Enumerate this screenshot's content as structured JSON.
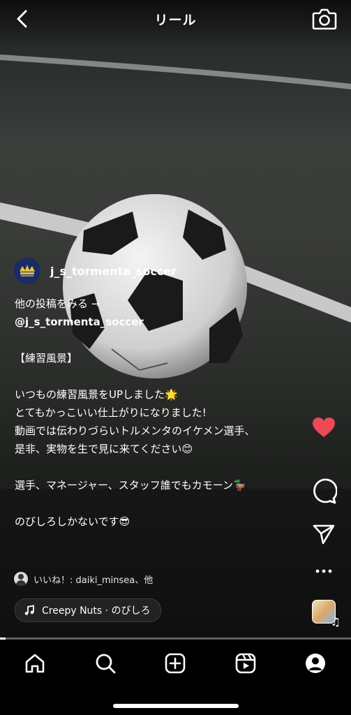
{
  "header": {
    "title": "リール"
  },
  "post": {
    "username": "j_s_tormenta_soccer",
    "caption": {
      "line1": "他の投稿をみる →",
      "line2": "@j_s_tormenta_soccer",
      "line3": "【練習風景】",
      "line4": "いつもの練習風景をUPしました🌟",
      "line5": "とてもかっこいい仕上がりになりました!",
      "line6": "動画では伝わりづらいトルメンタのイケメン選手、",
      "line7": "是非、実物を生で見に来てください😊",
      "line8": "選手、マネージャー、スタッフ誰でもカモーン🦆",
      "line9": "のびしろしかないです😎"
    },
    "likes_text": "いいね！: daiki_minsea、他",
    "music": "Creepy Nuts · のびしろ",
    "progress": 0.016
  },
  "colors": {
    "like": "#ed4956",
    "background": "#000000"
  },
  "icons": {
    "back": "chevron-left-icon",
    "camera": "camera-icon",
    "like": "heart-icon",
    "comment": "comment-icon",
    "share": "paper-plane-icon",
    "more": "more-icon",
    "home": "home-icon",
    "search": "search-icon",
    "create": "plus-square-icon",
    "reels": "reels-icon",
    "profile": "profile-icon"
  }
}
